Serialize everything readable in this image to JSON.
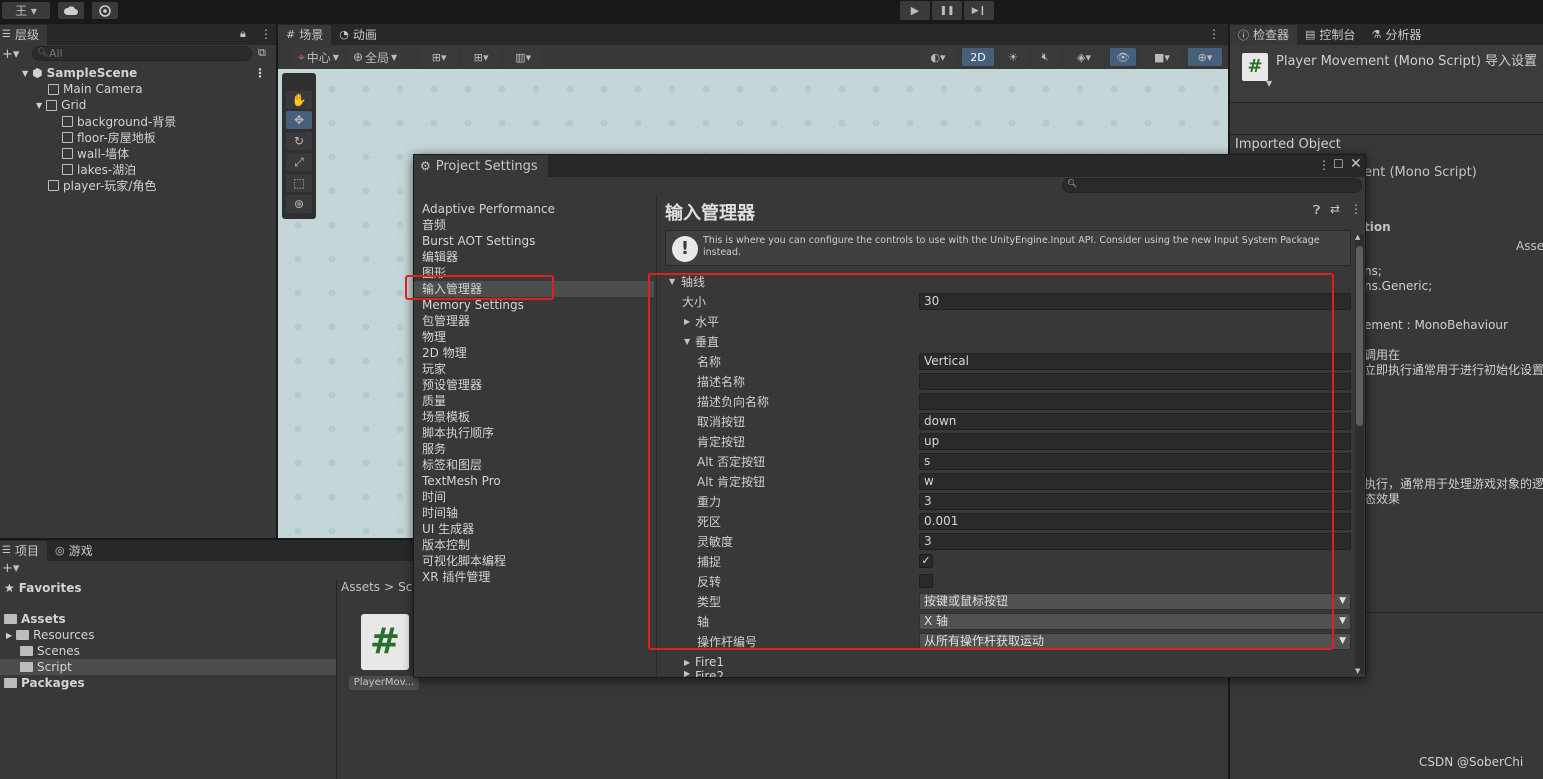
{
  "topbar": {
    "account_label": "王 ▾",
    "cloud_icon": "cloud-icon",
    "collab_icon": "collab-icon",
    "play_icon": "▶",
    "pause_icon": "❚❚",
    "step_icon": "▶❙"
  },
  "hierarchy": {
    "tab_label": "层级",
    "search_placeholder": "All",
    "scene_name": "SampleScene",
    "items": [
      {
        "label": "Main Camera"
      },
      {
        "label": "Grid"
      },
      {
        "label": "background-背景"
      },
      {
        "label": "floor-房屋地板"
      },
      {
        "label": "wall-墙体"
      },
      {
        "label": "lakes-湖泊"
      },
      {
        "label": "player-玩家/角色"
      }
    ]
  },
  "scene_view": {
    "tabs": [
      {
        "label": "场景"
      },
      {
        "label": "动画"
      }
    ],
    "pivot_label": "中心",
    "space_label": "全局",
    "mode_2d": "2D"
  },
  "project": {
    "tabs": [
      {
        "label": "项目"
      },
      {
        "label": "游戏"
      }
    ],
    "favorites_label": "Favorites",
    "assets_label": "Assets",
    "folders": [
      {
        "label": "Resources"
      },
      {
        "label": "Scenes"
      },
      {
        "label": "Script"
      }
    ],
    "packages_label": "Packages",
    "breadcrumb": {
      "root": "Assets",
      "sep": ">",
      "child": "Scr"
    },
    "asset_file": "PlayerMov..."
  },
  "inspector": {
    "tabs": [
      {
        "label": "检查器"
      },
      {
        "label": "控制台"
      },
      {
        "label": "分析器"
      }
    ],
    "title": "Player Movement (Mono Script) 导入设置",
    "imported_object": "Imported Object",
    "sub_title": "ent (Mono Script)",
    "section_label": "tion",
    "asset_label": "Asse",
    "code_lines": [
      "ns;",
      "ns.Generic;",
      "",
      "ement : MonoBehaviour",
      "",
      "调用在",
      "立即执行通常用于进行初始化设置",
      "",
      "",
      "",
      "",
      "",
      "执行，通常用于处理游戏对象的逻",
      "态效果"
    ]
  },
  "project_settings": {
    "window_title": "Project Settings",
    "search_placeholder": "",
    "nav_items": [
      {
        "label": "Adaptive Performance"
      },
      {
        "label": "音频"
      },
      {
        "label": "Burst AOT Settings"
      },
      {
        "label": "编辑器"
      },
      {
        "label": "图形"
      },
      {
        "label": "输入管理器",
        "selected": true
      },
      {
        "label": "Memory Settings"
      },
      {
        "label": "包管理器"
      },
      {
        "label": "物理"
      },
      {
        "label": "2D 物理"
      },
      {
        "label": "玩家"
      },
      {
        "label": "预设管理器"
      },
      {
        "label": "质量"
      },
      {
        "label": "场景模板"
      },
      {
        "label": "脚本执行顺序"
      },
      {
        "label": "服务"
      },
      {
        "label": "标签和图层"
      },
      {
        "label": "TextMesh Pro"
      },
      {
        "label": "时间"
      },
      {
        "label": "时间轴"
      },
      {
        "label": "UI 生成器"
      },
      {
        "label": "版本控制"
      },
      {
        "label": "可视化脚本编程"
      },
      {
        "label": "XR 插件管理"
      }
    ],
    "page_title": "输入管理器",
    "help_text": "This is where you can configure the controls to use with the UnityEngine.Input API. Consider using the new Input System Package instead.",
    "axes": {
      "label": "轴线",
      "size_label": "大小",
      "size_value": "30",
      "horizontal_label": "水平",
      "vertical_label": "垂直",
      "fields": [
        {
          "label": "名称",
          "value": "Vertical"
        },
        {
          "label": "描述名称",
          "value": ""
        },
        {
          "label": "描述负向名称",
          "value": ""
        },
        {
          "label": "取消按钮",
          "value": "down"
        },
        {
          "label": "肯定按钮",
          "value": "up"
        },
        {
          "label": "Alt 否定按钮",
          "value": "s"
        },
        {
          "label": "Alt 肯定按钮",
          "value": "w"
        },
        {
          "label": "重力",
          "value": "3"
        },
        {
          "label": "死区",
          "value": "0.001"
        },
        {
          "label": "灵敏度",
          "value": "3"
        }
      ],
      "snap_label": "捕捉",
      "snap_checked": "✓",
      "invert_label": "反转",
      "type_label": "类型",
      "type_value": "按键或鼠标按钮",
      "axis_label": "轴",
      "axis_value": "X 轴",
      "joy_label": "操作杆编号",
      "joy_value": "从所有操作杆获取运动",
      "fire1_label": "Fire1",
      "fire2_label": "Fire2"
    }
  },
  "watermark": "CSDN @SoberChi",
  "colors": {
    "highlight_red": "#e02020",
    "selection": "#2c5d87",
    "panel_bg": "#383838"
  }
}
